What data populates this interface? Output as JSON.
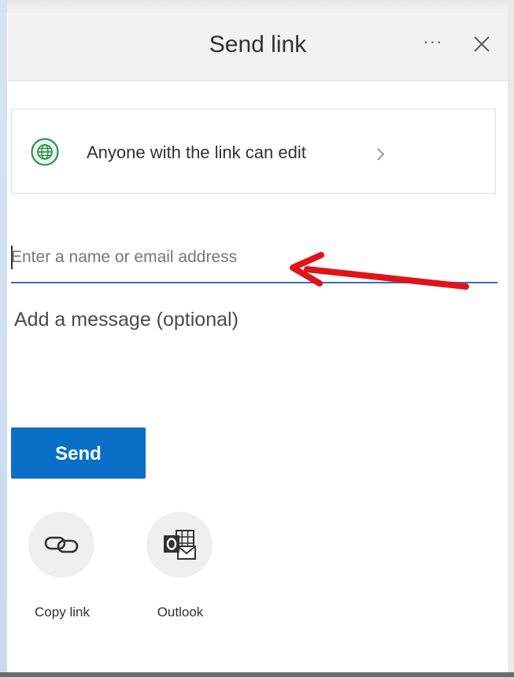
{
  "dialog": {
    "title": "Send link",
    "more_label": "···",
    "close_icon": "close-icon",
    "more_icon": "more-horizontal-icon"
  },
  "permission": {
    "text": "Anyone with the link can edit",
    "icon": "globe-icon",
    "chevron_icon": "chevron-right-icon"
  },
  "recipient": {
    "placeholder": "Enter a name or email address",
    "value": ""
  },
  "message": {
    "placeholder": "Add a message (optional)"
  },
  "send": {
    "label": "Send"
  },
  "share_options": [
    {
      "label": "Copy link",
      "icon": "link-icon"
    },
    {
      "label": "Outlook",
      "icon": "outlook-icon"
    }
  ],
  "colors": {
    "accent": "#0a6fc7",
    "input_underline": "#2b73c2",
    "globe_green": "#1e8a3c",
    "annotation_red": "#e0131a",
    "header_bg": "#f3f2f1"
  }
}
